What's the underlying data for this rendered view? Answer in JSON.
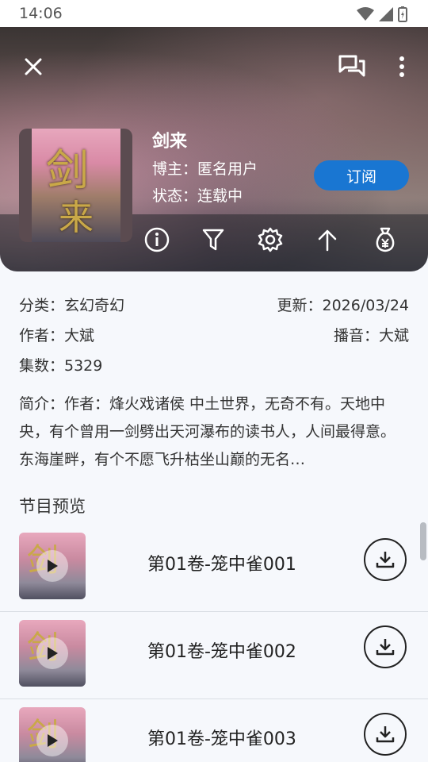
{
  "statusbar": {
    "time": "14:06"
  },
  "header": {
    "title": "剑来",
    "blogger": "博主：匿名用户",
    "status": "状态：连载中",
    "subscribe_label": "订阅",
    "cover_glyph_top": "剑",
    "cover_glyph_bottom": "来"
  },
  "toolbar": [
    "info-icon",
    "filter-icon",
    "settings-icon",
    "arrow-up-icon",
    "money-bag-icon"
  ],
  "details": {
    "category": "分类：玄幻奇幻",
    "updated": "更新：2026/03/24",
    "author": "作者：大斌",
    "narrator": "播音：大斌",
    "episodes": "集数：5329",
    "summary": "简介：作者：烽火戏诸侯 中土世界，无奇不有。天地中央，有个曾用一剑劈出天河瀑布的读书人，人间最得意。东海崖畔，有个不愿飞升枯坐山巅的无名…"
  },
  "section_title": "节目预览",
  "episodes": [
    {
      "title": "第01卷-笼中雀001"
    },
    {
      "title": "第01卷-笼中雀002"
    },
    {
      "title": "第01卷-笼中雀003"
    }
  ],
  "colors": {
    "accent": "#1976d2",
    "background": "#f6f8fc"
  }
}
